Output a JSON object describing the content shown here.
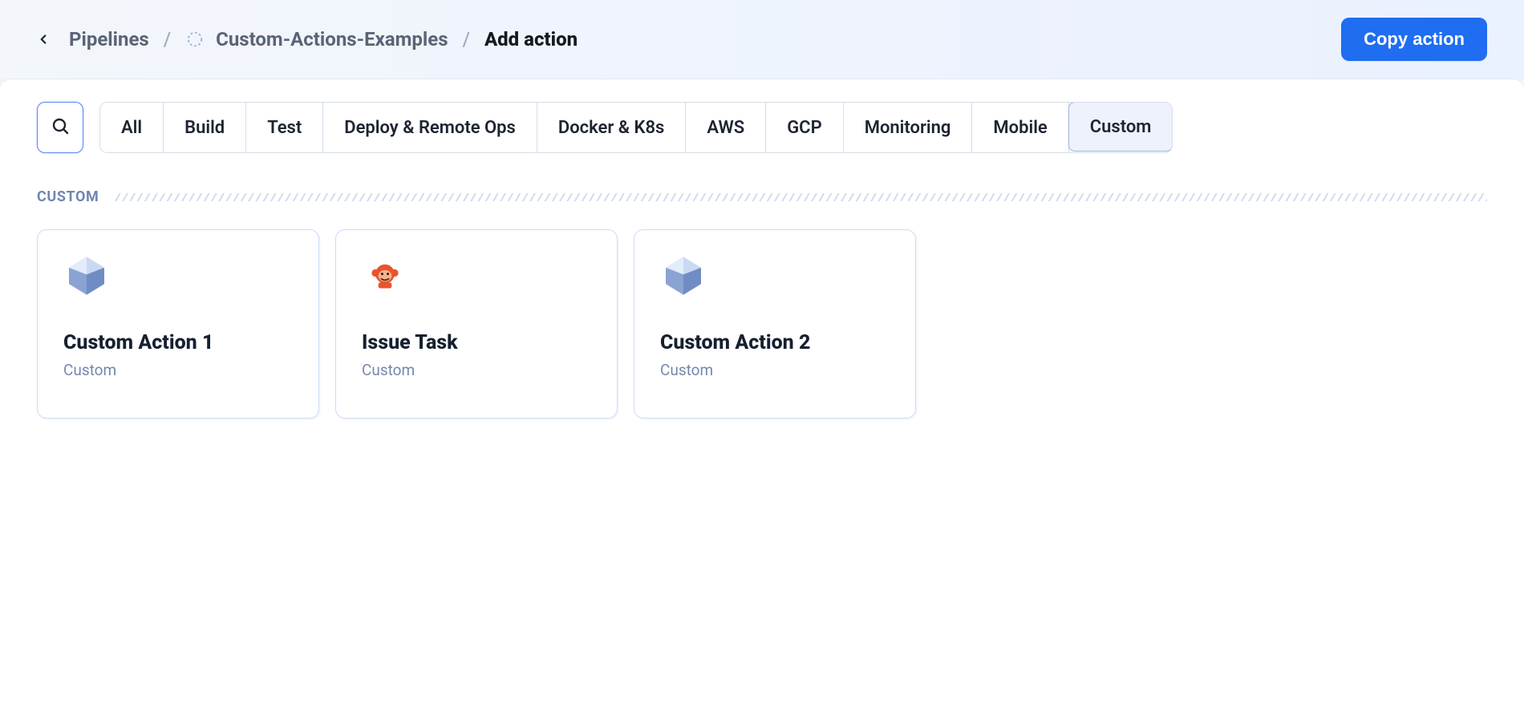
{
  "header": {
    "breadcrumb": {
      "root": "Pipelines",
      "project": "Custom-Actions-Examples",
      "current": "Add action"
    },
    "copy_button": "Copy action"
  },
  "tabs": {
    "items": [
      "All",
      "Build",
      "Test",
      "Deploy & Remote Ops",
      "Docker & K8s",
      "AWS",
      "GCP",
      "Monitoring",
      "Mobile",
      "Custom"
    ],
    "active": "Custom"
  },
  "section": {
    "title": "CUSTOM"
  },
  "cards": [
    {
      "title": "Custom Action 1",
      "subtitle": "Custom",
      "icon": "polyhedron"
    },
    {
      "title": "Issue Task",
      "subtitle": "Custom",
      "icon": "monkey"
    },
    {
      "title": "Custom Action 2",
      "subtitle": "Custom",
      "icon": "polyhedron"
    }
  ]
}
